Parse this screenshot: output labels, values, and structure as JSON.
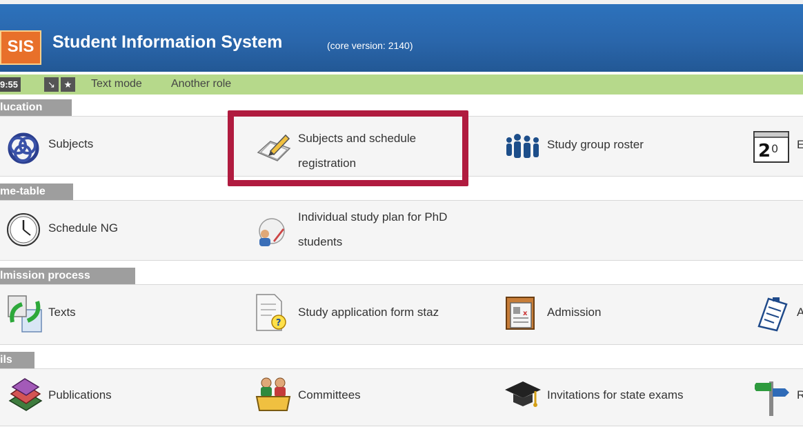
{
  "header": {
    "logo": "SIS",
    "title": "Student Information System",
    "version": "(core version: 2140)"
  },
  "toolbar": {
    "clock": "9:55",
    "text_mode": "Text mode",
    "another_role": "Another role"
  },
  "sections": {
    "education": "lucation",
    "timetable": "me-table",
    "admission": "lmission process",
    "details": "ils"
  },
  "items": {
    "subjects": "Subjects",
    "subjects_reg_1": "Subjects and schedule",
    "subjects_reg_2": "registration",
    "study_group": "Study group roster",
    "schedule_ng": "Schedule NG",
    "isp_1": "Individual study plan for PhD",
    "isp_2": "students",
    "texts": "Texts",
    "study_app": "Study application form staz",
    "admission": "Admission",
    "publications": "Publications",
    "committees": "Committees",
    "invitations": "Invitations for state exams",
    "partial_e": "E",
    "partial_a": "A",
    "partial_r": "R"
  },
  "colors": {
    "header_blue": "#2a66ab",
    "toolbar_green": "#b6d98b",
    "highlight": "#b01b3f",
    "section_gray": "#9e9e9e"
  }
}
